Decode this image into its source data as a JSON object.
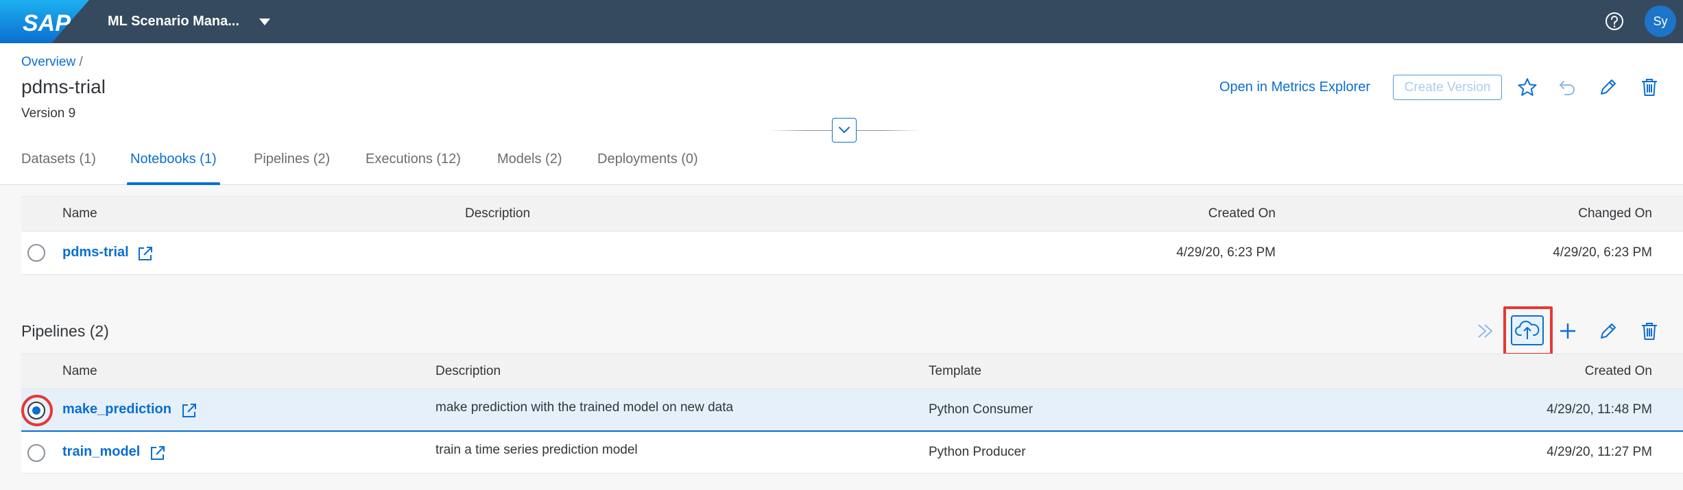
{
  "shell": {
    "logo_text": "SAP",
    "app_title": "ML Scenario Mana...",
    "avatar_initials": "Sy",
    "brand_color": "#354a5f",
    "accent_color": "#0a6ed1"
  },
  "header": {
    "breadcrumb": {
      "link": "Overview",
      "separator": "/"
    },
    "title": "pdms-trial",
    "subtitle": "Version 9",
    "actions": {
      "metrics_link": "Open in Metrics Explorer",
      "create_version": "Create Version"
    }
  },
  "tabs": [
    {
      "label": "Datasets (1)"
    },
    {
      "label": "Notebooks (1)",
      "active": true
    },
    {
      "label": "Pipelines (2)"
    },
    {
      "label": "Executions (12)"
    },
    {
      "label": "Models (2)"
    },
    {
      "label": "Deployments (0)"
    }
  ],
  "notebooks": {
    "columns": [
      "Name",
      "Description",
      "Created On",
      "Changed On"
    ],
    "rows": [
      {
        "name": "pdms-trial",
        "description": "",
        "created_on": "4/29/20, 6:23 PM",
        "changed_on": "4/29/20, 6:23 PM"
      }
    ]
  },
  "pipelines": {
    "title": "Pipelines (2)",
    "columns": [
      "Name",
      "Description",
      "Template",
      "Created On"
    ],
    "rows": [
      {
        "name": "make_prediction",
        "description": "make prediction with the trained model on new data",
        "template": "Python Consumer",
        "created_on": "4/29/20, 11:48 PM",
        "selected": true
      },
      {
        "name": "train_model",
        "description": "train a time series prediction model",
        "template": "Python Producer",
        "created_on": "4/29/20, 11:27 PM",
        "selected": false
      }
    ]
  },
  "icons": {
    "header": [
      "favorite-icon",
      "undo-icon",
      "edit-icon",
      "delete-icon"
    ],
    "pipelines_toolbar": [
      "execute-icon",
      "upload-cloud-icon",
      "add-icon",
      "edit-icon",
      "delete-icon"
    ]
  }
}
